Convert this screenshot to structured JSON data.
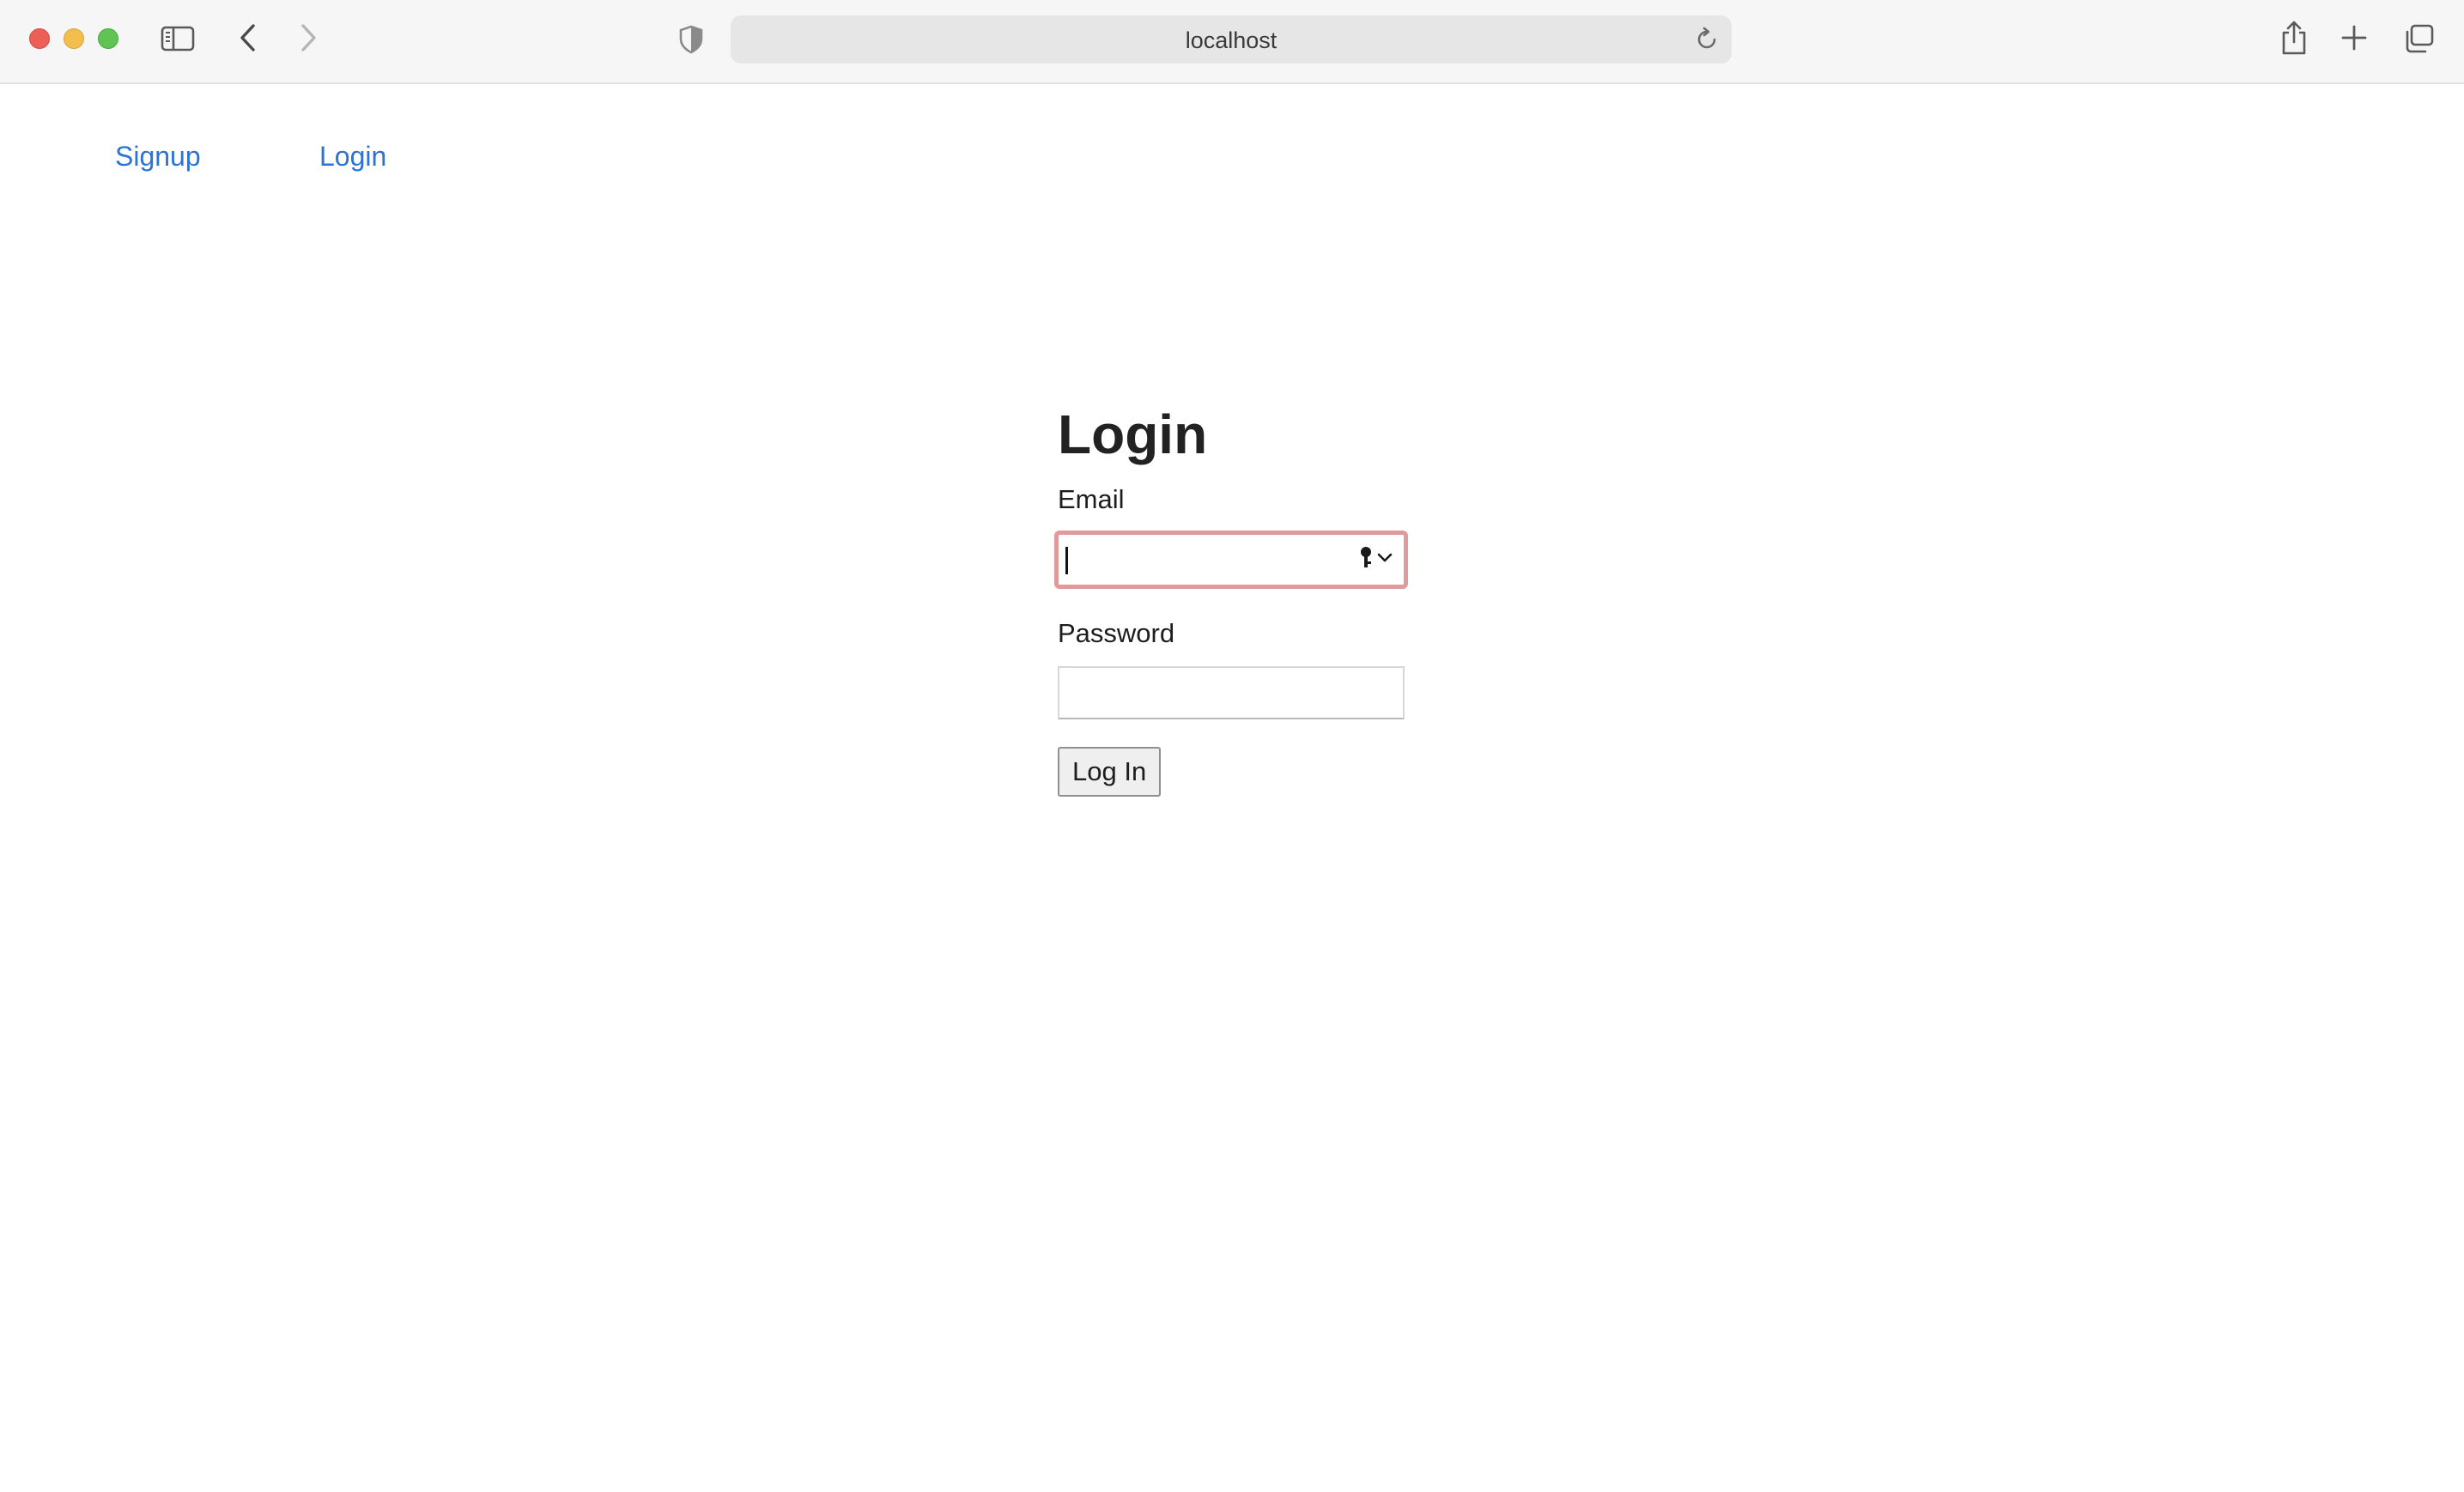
{
  "browser": {
    "url": "localhost"
  },
  "nav": {
    "links": [
      {
        "label": "Signup"
      },
      {
        "label": "Login"
      }
    ]
  },
  "form": {
    "title": "Login",
    "email": {
      "label": "Email",
      "value": "",
      "placeholder": ""
    },
    "password": {
      "label": "Password",
      "value": "",
      "placeholder": ""
    },
    "submit_label": "Log In"
  },
  "colors": {
    "link": "#2a73d9",
    "focus_ring": "#e09a9a",
    "chrome_bg": "#f6f6f6"
  },
  "icons": [
    "close-window-icon",
    "minimize-window-icon",
    "zoom-window-icon",
    "sidebar-icon",
    "back-icon",
    "forward-icon",
    "privacy-shield-icon",
    "reload-icon",
    "share-icon",
    "new-tab-icon",
    "tab-overview-icon",
    "key-icon",
    "chevron-down-icon"
  ]
}
